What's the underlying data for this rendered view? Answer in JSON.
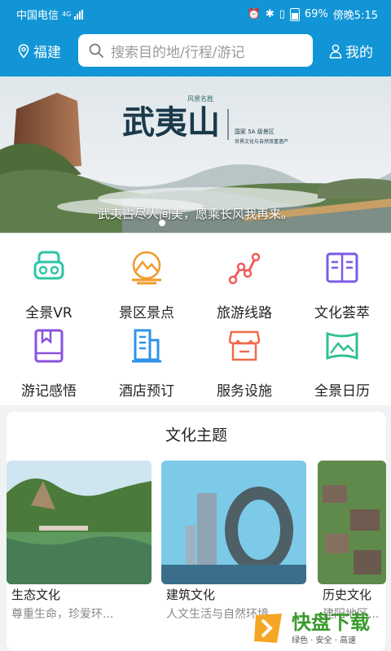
{
  "status_bar": {
    "carrier": "中国电信",
    "network": "4G",
    "battery": "69%",
    "time": "傍晚5:15"
  },
  "header": {
    "location": "福建",
    "search_placeholder": "搜索目的地/行程/游记",
    "mine_label": "我的"
  },
  "banner": {
    "logo_title": "武夷山",
    "logo_seal": "风景名胜",
    "tag_line1": "国家 5A 级景区",
    "tag_line2": "世界文化与自然双重遗产",
    "caption": "武夷占尽人间美，愿乘长风我再来。"
  },
  "categories": [
    {
      "label": "全景VR",
      "icon": "vr-headset-icon",
      "color": "#2ec5a5"
    },
    {
      "label": "景区景点",
      "icon": "mountain-icon",
      "color": "#f19a2b"
    },
    {
      "label": "旅游线路",
      "icon": "route-icon",
      "color": "#f05a5a"
    },
    {
      "label": "文化荟萃",
      "icon": "book-open-icon",
      "color": "#7b5ce6"
    },
    {
      "label": "游记感悟",
      "icon": "journal-icon",
      "color": "#8a52e0"
    },
    {
      "label": "酒店预订",
      "icon": "hotel-building-icon",
      "color": "#2f93e8"
    },
    {
      "label": "服务设施",
      "icon": "shop-icon",
      "color": "#f06a4a"
    },
    {
      "label": "全景日历",
      "icon": "panorama-icon",
      "color": "#2fc18f"
    }
  ],
  "culture": {
    "title": "文化主题",
    "cards": [
      {
        "name": "生态文化",
        "desc": "尊重生命，珍爱环..."
      },
      {
        "name": "建筑文化",
        "desc": "人文生活与自然环境"
      },
      {
        "name": "历史文化",
        "desc": "建阳地区..."
      }
    ]
  },
  "watermark": {
    "brand": "快盘下载",
    "slogan": "绿色 · 安全 · 高速"
  }
}
